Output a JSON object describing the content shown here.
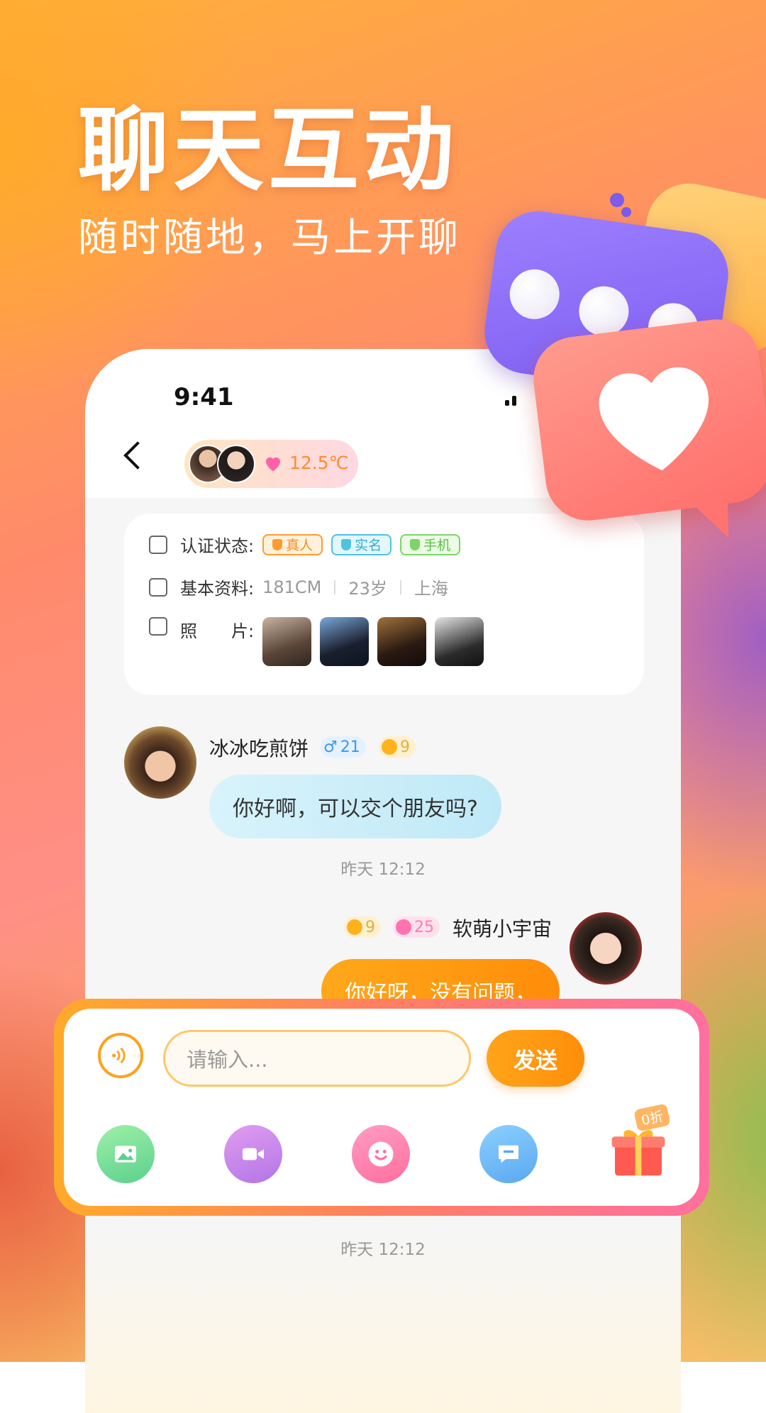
{
  "hero": {
    "title": "聊天互动",
    "subtitle": "随时随地，马上开聊"
  },
  "status_bar": {
    "time": "9:41"
  },
  "header": {
    "intimacy_temp": "12.5℃"
  },
  "profile_card": {
    "cert_label": "认证状态:",
    "cert_tags": [
      "真人",
      "实名",
      "手机"
    ],
    "basic_label": "基本资料:",
    "basic_values": [
      "181CM",
      "23岁",
      "上海"
    ],
    "photos_label": "照　　片:"
  },
  "messages": [
    {
      "name": "冰冰吃煎饼",
      "gender_age": "21",
      "level": "9",
      "text": "你好啊，可以交个朋友吗?",
      "time": "昨天 12:12"
    },
    {
      "name": "软萌小宇宙",
      "gender_age": "25",
      "level": "9",
      "text": "你好呀，没有问题，",
      "time": "昨天 12:12"
    }
  ],
  "input_bar": {
    "placeholder": "请输入...",
    "send_label": "发送",
    "gift_badge": "0折"
  },
  "colors": {
    "accent": "#ff9a1a",
    "brand_pink": "#ff6f9e"
  }
}
